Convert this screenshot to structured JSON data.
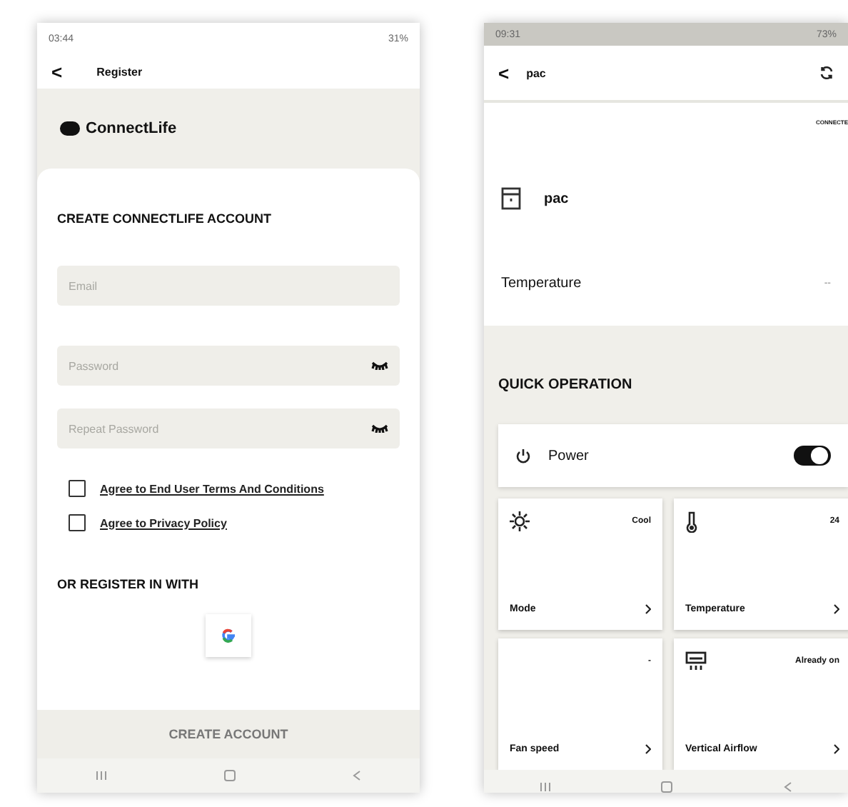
{
  "register_screen": {
    "status_bar": {
      "time": "03:44",
      "battery": "31%"
    },
    "header": {
      "back": "<",
      "title": "Register"
    },
    "brand": {
      "name": "ConnectLife"
    },
    "form": {
      "heading": "CREATE CONNECTLIFE ACCOUNT",
      "fields": [
        {
          "placeholder": "Email",
          "kind": "text"
        },
        {
          "placeholder": "Password",
          "kind": "password"
        },
        {
          "placeholder": "Repeat Password",
          "kind": "password"
        }
      ],
      "agreements": [
        {
          "label": "Agree to End User Terms And Conditions",
          "checked": false
        },
        {
          "label": "Agree to Privacy Policy",
          "checked": false
        }
      ],
      "social_heading": "OR REGISTER IN WITH"
    },
    "footer_button": "CREATE ACCOUNT"
  },
  "device_screen": {
    "status_bar": {
      "time": "09:31",
      "battery": "73%"
    },
    "header": {
      "back": "<",
      "title": "pac"
    },
    "brand_text": "CONNECTE",
    "device_name": "pac",
    "temperature_row": {
      "label": "Temperature",
      "value": "--"
    },
    "section_title": "QUICK OPERATION",
    "power": {
      "label": "Power",
      "on": true
    },
    "tiles": [
      {
        "kind": "mode",
        "label": "Mode",
        "value": "Cool"
      },
      {
        "kind": "temperature",
        "label": "Temperature",
        "value": "24"
      },
      {
        "kind": "fan",
        "label": "Fan speed",
        "value": "-"
      },
      {
        "kind": "airflow",
        "label": "Vertical Airflow",
        "value": "Already on"
      }
    ]
  }
}
